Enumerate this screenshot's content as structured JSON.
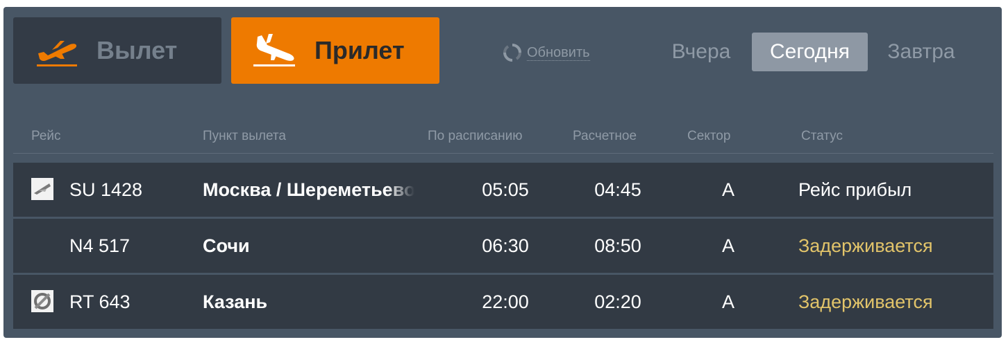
{
  "tabs": {
    "departure": {
      "label": "Вылет"
    },
    "arrival": {
      "label": "Прилет",
      "active": true
    }
  },
  "refresh": {
    "label": "Обновить",
    "icon": "refresh-icon"
  },
  "days": {
    "yesterday": "Вчера",
    "today": "Сегодня",
    "tomorrow": "Завтра",
    "selected": "today"
  },
  "table": {
    "columns": {
      "flight": "Рейс",
      "origin": "Пункт вылета",
      "scheduled": "По расписанию",
      "estimated": "Расчетное",
      "sector": "Сектор",
      "status": "Статус"
    },
    "rows": [
      {
        "logo": "airline-logo-icon",
        "flight": "SU 1428",
        "origin": "Москва / Шереметьево",
        "scheduled": "05:05",
        "estimated": "04:45",
        "sector": "A",
        "status": "Рейс прибыл",
        "status_type": "arrived"
      },
      {
        "logo": "",
        "flight": "N4 517",
        "origin": "Сочи",
        "scheduled": "06:30",
        "estimated": "08:50",
        "sector": "A",
        "status": "Задерживается",
        "status_type": "delayed"
      },
      {
        "logo": "airline-logo-icon",
        "flight": "RT 643",
        "origin": "Казань",
        "scheduled": "22:00",
        "estimated": "02:20",
        "sector": "A",
        "status": "Задерживается",
        "status_type": "delayed"
      }
    ]
  },
  "colors": {
    "board_bg": "#485665",
    "row_bg": "#323a44",
    "accent": "#ee7a00",
    "delayed": "#e2c46a",
    "muted": "#8f9aa6"
  }
}
